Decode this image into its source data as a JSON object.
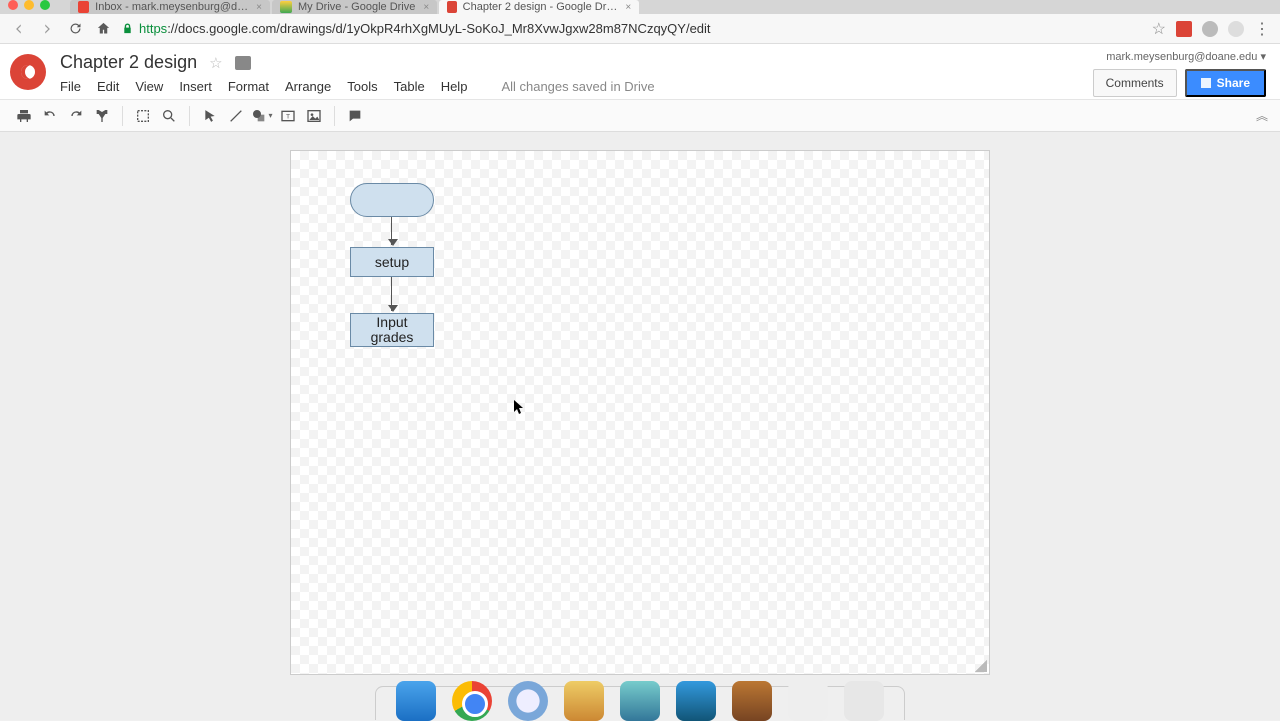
{
  "browser": {
    "tabs": [
      {
        "title": "Inbox - mark.meysenburg@d…",
        "active": false
      },
      {
        "title": "My Drive - Google Drive",
        "active": false
      },
      {
        "title": "Chapter 2 design - Google Dr…",
        "active": true
      }
    ],
    "url_scheme": "https",
    "url_rest": "://docs.google.com/drawings/d/1yOkpR4rhXgMUyL-SoKoJ_Mr8XvwJgxw28m87NCzqyQY/edit"
  },
  "doc": {
    "title": "Chapter 2 design",
    "menus": [
      "File",
      "Edit",
      "View",
      "Insert",
      "Format",
      "Arrange",
      "Tools",
      "Table",
      "Help"
    ],
    "save_status": "All changes saved in Drive",
    "user_email": "mark.meysenburg@doane.edu",
    "comments_label": "Comments",
    "share_label": "Share"
  },
  "toolbar_icons": [
    "print-icon",
    "undo-icon",
    "redo-icon",
    "paint-format-icon",
    "|",
    "fit-icon",
    "zoom-icon",
    "|",
    "select-icon",
    "line-icon",
    "shape-icon",
    "textbox-icon",
    "image-icon",
    "|",
    "comment-icon"
  ],
  "flowchart": {
    "node1_label": "",
    "node2_label": "setup",
    "node3_label": "Input\ngrades"
  }
}
